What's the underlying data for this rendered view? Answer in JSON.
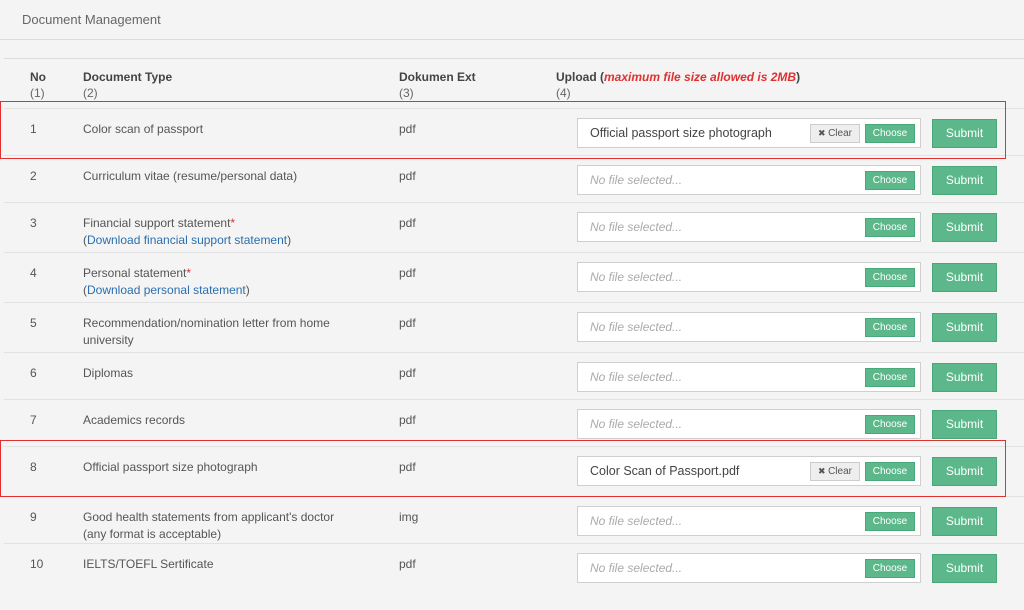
{
  "panel": {
    "title": "Document Management"
  },
  "table": {
    "headers": {
      "no": "No",
      "no_sub": "(1)",
      "type": "Document Type",
      "type_sub": "(2)",
      "ext": "Dokumen Ext",
      "ext_sub": "(3)",
      "upload": "Upload",
      "upload_note_open": " (",
      "upload_note": "maximum file size allowed is 2MB",
      "upload_note_close": ")",
      "upload_sub": "(4)"
    },
    "choose_label": "Choose",
    "clear_label": "Clear",
    "submit_label": "Submit",
    "rows": [
      {
        "no": "1",
        "type": "Color scan of passport",
        "ext": "pdf",
        "file": "Official passport size photograph"
      },
      {
        "no": "2",
        "type": "Curriculum vitae (resume/personal data)",
        "ext": "pdf",
        "file": "No file selected..."
      },
      {
        "no": "3",
        "type": "Financial support statement",
        "req": "*",
        "link": "Download financial support statement",
        "ext": "pdf",
        "file": "No file selected..."
      },
      {
        "no": "4",
        "type": "Personal statement",
        "req": "*",
        "link": "Download personal statement",
        "ext": "pdf",
        "file": "No file selected..."
      },
      {
        "no": "5",
        "type": "Recommendation/nomination letter from home",
        "type2": "university",
        "ext": "pdf",
        "file": "No file selected..."
      },
      {
        "no": "6",
        "type": "Diplomas",
        "ext": "pdf",
        "file": "No file selected..."
      },
      {
        "no": "7",
        "type": "Academics records",
        "ext": "pdf",
        "file": "No file selected..."
      },
      {
        "no": "8",
        "type": "Official passport size photograph",
        "ext": "pdf",
        "file": "Color Scan of Passport.pdf"
      },
      {
        "no": "9",
        "type": "Good health statements from applicant's doctor",
        "type2": "(any format is acceptable)",
        "ext": "img",
        "file": "No file selected..."
      },
      {
        "no": "10",
        "type": "IELTS/TOEFL Sertificate",
        "ext": "pdf",
        "file": "No file selected..."
      }
    ]
  },
  "colors": {
    "accent_green": "#5cb88a",
    "required_red": "#e03030",
    "link_blue": "#2a6fb0",
    "highlight_red": "#e03030"
  }
}
